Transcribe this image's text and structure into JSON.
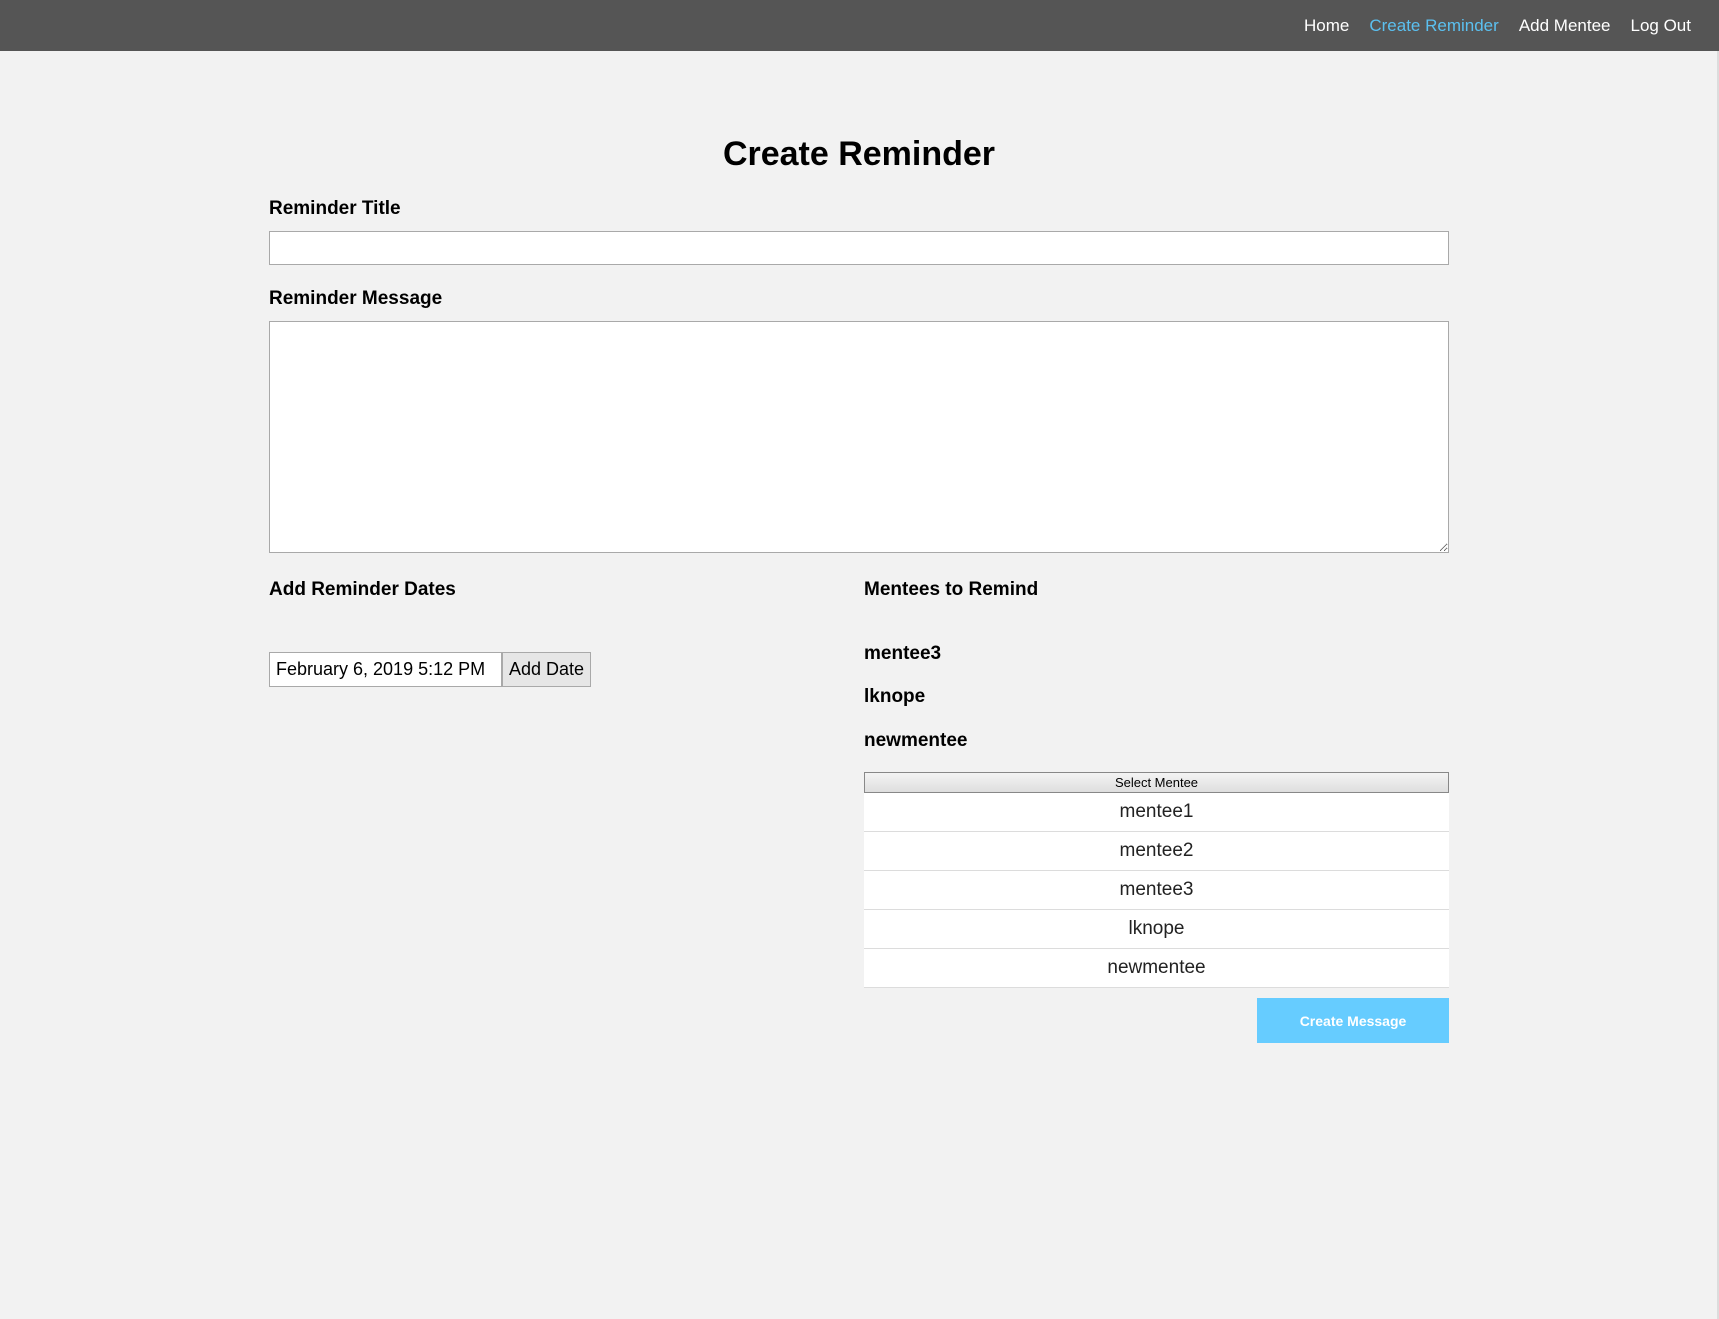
{
  "nav": {
    "items": [
      {
        "label": "Home"
      },
      {
        "label": "Create Reminder",
        "active": true
      },
      {
        "label": "Add Mentee"
      },
      {
        "label": "Log Out"
      }
    ]
  },
  "colors": {
    "navbar": "#555555",
    "nav_active": "#5bc0f0",
    "primary_button": "#66ccff",
    "background": "#f2f2f2"
  },
  "page": {
    "title": "Create Reminder"
  },
  "form": {
    "title_label": "Reminder Title",
    "title_value": "",
    "message_label": "Reminder Message",
    "message_value": "",
    "dates_label": "Add Reminder Dates",
    "date_value": "February 6, 2019 5:12 PM",
    "add_date_label": "Add Date",
    "mentees_label": "Mentees to Remind",
    "selected_mentees": [
      "mentee3",
      "lknope",
      "newmentee"
    ],
    "select_mentee_label": "Select Mentee",
    "mentee_options": [
      "mentee1",
      "mentee2",
      "mentee3",
      "lknope",
      "newmentee"
    ],
    "submit_label": "Create Message"
  }
}
